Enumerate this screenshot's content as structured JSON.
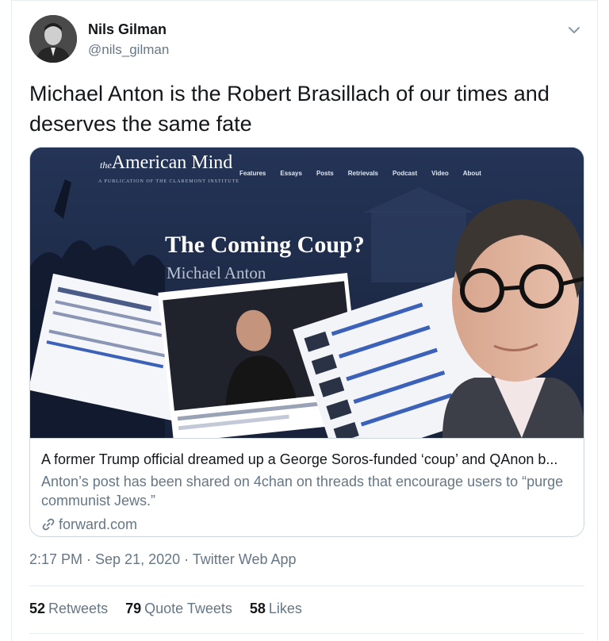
{
  "author": {
    "display_name": "Nils Gilman",
    "handle": "@nils_gilman",
    "avatar_icon": "person-avatar"
  },
  "tweet": {
    "text": "Michael Anton is the Robert Brasillach of our times and deserves the same fate"
  },
  "card": {
    "image": {
      "site_prefix": "the",
      "site_name": "American Mind",
      "site_tagline": "A PUBLICATION OF THE CLAREMONT INSTITUTE",
      "nav": [
        "Features",
        "Essays",
        "Posts",
        "Retrievals",
        "Podcast",
        "Video",
        "About"
      ],
      "headline": "The Coming Coup?",
      "byline": "Michael Anton"
    },
    "title": "A former Trump official dreamed up a George Soros-funded ‘coup’ and QAnon b...",
    "description": "Anton’s post has been shared on 4chan on threads that encourage users to “purge communist Jews.”",
    "domain": "forward.com",
    "link_icon": "link-icon"
  },
  "meta": {
    "timestamp": "2:17 PM · Sep 21, 2020 · Twitter Web App"
  },
  "stats": {
    "retweets_count": "52",
    "retweets_label": "Retweets",
    "quotes_count": "79",
    "quotes_label": "Quote Tweets",
    "likes_count": "58",
    "likes_label": "Likes"
  },
  "colors": {
    "text_primary": "#14171a",
    "text_secondary": "#657786",
    "border": "#ccd6dd",
    "card_image_bg": "#1d2b4a"
  }
}
